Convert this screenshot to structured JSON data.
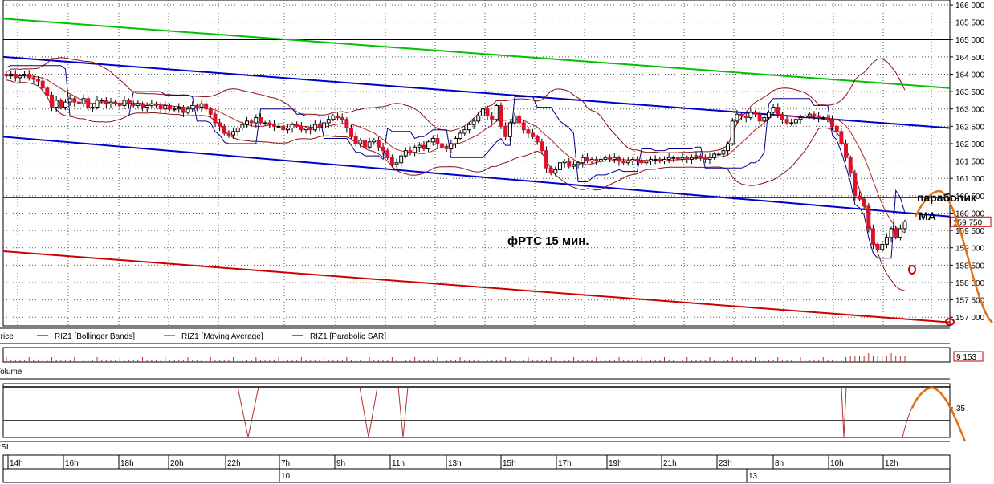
{
  "chart_data": [
    {
      "type": "candlestick",
      "annotation": "фРТС   15 мин.",
      "y_axis": {
        "min": 156750,
        "max": 166000,
        "step": 500,
        "tick_labels": [
          "166 000",
          "165 500",
          "165 000",
          "164 500",
          "164 000",
          "163 500",
          "163 000",
          "162 500",
          "162 000",
          "161 500",
          "161 000",
          "160 500",
          "160 000",
          "159 500",
          "159 000",
          "158 500",
          "158 000",
          "157 500",
          "157 000"
        ]
      },
      "last_price": 159750,
      "last_price_label": "159 750",
      "legend": [
        {
          "name": "Price",
          "color": "#000000"
        },
        {
          "name": "RIZ1 [Bollinger Bands]",
          "color": "#8b0000"
        },
        {
          "name": "RIZ1 [Moving Average]",
          "color": "#a52a2a"
        },
        {
          "name": "RIZ1 [Parabolic SAR]",
          "color": "#00008b"
        }
      ],
      "horizontal_levels": [
        165000,
        160450
      ],
      "trend_lines": [
        {
          "name": "green channel top",
          "color": "#00c000",
          "from": [
            0,
            165600
          ],
          "to": [
            240,
            163600
          ]
        },
        {
          "name": "blue channel top",
          "color": "#0000cc",
          "from": [
            0,
            164500
          ],
          "to": [
            240,
            162450
          ]
        },
        {
          "name": "blue channel bottom",
          "color": "#0000cc",
          "from": [
            0,
            162200
          ],
          "to": [
            240,
            159900
          ]
        },
        {
          "name": "red channel bottom",
          "color": "#cc0000",
          "from": [
            0,
            158900
          ],
          "to": [
            240,
            156850
          ]
        }
      ],
      "hand_annotations": [
        {
          "text": "параболик",
          "color": "#000000"
        },
        {
          "text": "MA",
          "color": "#000000"
        }
      ],
      "close_series": [
        163950,
        164000,
        163900,
        163950,
        164000,
        163900,
        163850,
        163800,
        163600,
        163400,
        163050,
        163250,
        163050,
        163200,
        163300,
        163200,
        163150,
        163300,
        163050,
        163050,
        163250,
        163250,
        163150,
        163200,
        163150,
        163100,
        163250,
        163150,
        163100,
        163150,
        163050,
        163100,
        163150,
        163100,
        163000,
        163100,
        163000,
        163000,
        163050,
        162900,
        163000,
        163100,
        163050,
        163150,
        163000,
        162850,
        162600,
        162500,
        162300,
        162250,
        162350,
        162450,
        162550,
        162650,
        162600,
        162750,
        162600,
        162600,
        162550,
        162500,
        162500,
        162400,
        162450,
        162550,
        162500,
        162400,
        162450,
        162400,
        162550,
        162450,
        162600,
        162700,
        162800,
        162750,
        162700,
        162450,
        162200,
        162000,
        162100,
        161900,
        162050,
        162100,
        161900,
        161800,
        161600,
        161400,
        161450,
        161650,
        161800,
        161750,
        161900,
        161950,
        161850,
        162050,
        162150,
        162000,
        161900,
        161850,
        162000,
        162150,
        162300,
        162400,
        162550,
        162650,
        162800,
        163000,
        162800,
        162700,
        163100,
        162500,
        162200,
        162600,
        162800,
        162600,
        162400,
        162300,
        162200,
        162050,
        161800,
        161300,
        161150,
        161250,
        161450,
        161500,
        161350,
        161400,
        161450,
        161600,
        161500,
        161550,
        161500,
        161550,
        161600,
        161550,
        161600,
        161500,
        161450,
        161500,
        161550,
        161500,
        161450,
        161500,
        161550,
        161550,
        161500,
        161550,
        161600,
        161600,
        161550,
        161600,
        161550,
        161600,
        161650,
        161600,
        161550,
        161600,
        161700,
        161700,
        161800,
        162000,
        162650,
        162850,
        162800,
        162750,
        162900,
        162850,
        162650,
        162750,
        162900,
        163050,
        162850,
        162700,
        162600,
        162600,
        162700,
        162750,
        162800,
        162850,
        162800,
        162750,
        162750,
        162700,
        162500,
        162350,
        162000,
        161600,
        161150,
        160500,
        160400,
        160200,
        159550,
        159100,
        158950,
        159100,
        159300,
        159550,
        159300,
        159550,
        159750
      ],
      "volume": {
        "last_label": "9 153"
      },
      "rsi": {
        "level_label": "35"
      },
      "x_axis": {
        "tick_labels": [
          "14h",
          "16h",
          "18h",
          "20h",
          "22h",
          "7h",
          "9h",
          "11h",
          "13h",
          "15h",
          "17h",
          "19h",
          "21h",
          "23h",
          "8h",
          "10h",
          "12h"
        ],
        "date_labels": [
          "10",
          "13"
        ]
      },
      "panel_labels": [
        "Volume",
        "RSI"
      ]
    }
  ]
}
